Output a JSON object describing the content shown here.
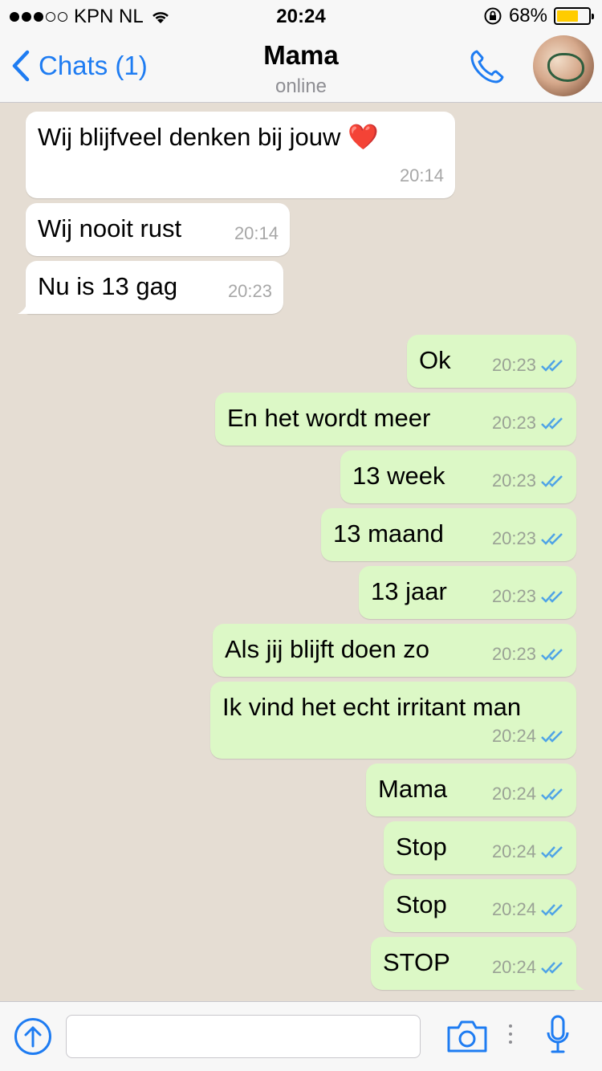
{
  "status_bar": {
    "carrier": "KPN NL",
    "time": "20:24",
    "battery": "68%"
  },
  "nav": {
    "back_label": "Chats (1)",
    "contact_name": "Mama",
    "contact_status": "online"
  },
  "messages": [
    {
      "dir": "in",
      "text": "Wij blijfveel denken bij jouw ❤️",
      "time": "20:14"
    },
    {
      "dir": "in",
      "text": "Wij nooit rust",
      "time": "20:14"
    },
    {
      "dir": "in",
      "text": "Nu is 13 gag",
      "time": "20:23"
    },
    {
      "dir": "out",
      "text": "Ok",
      "time": "20:23"
    },
    {
      "dir": "out",
      "text": "En het wordt meer",
      "time": "20:23"
    },
    {
      "dir": "out",
      "text": "13 week",
      "time": "20:23"
    },
    {
      "dir": "out",
      "text": "13 maand",
      "time": "20:23"
    },
    {
      "dir": "out",
      "text": "13 jaar",
      "time": "20:23"
    },
    {
      "dir": "out",
      "text": "Als jij blijft doen zo",
      "time": "20:23"
    },
    {
      "dir": "out",
      "text": "Ik vind het echt irritant man",
      "time": "20:24"
    },
    {
      "dir": "out",
      "text": "Mama",
      "time": "20:24"
    },
    {
      "dir": "out",
      "text": "Stop",
      "time": "20:24"
    },
    {
      "dir": "out",
      "text": "Stop",
      "time": "20:24"
    },
    {
      "dir": "out",
      "text": "STOP",
      "time": "20:24"
    }
  ],
  "colors": {
    "accent": "#1e7cf2",
    "outgoing_bubble": "#dcf8c6",
    "incoming_bubble": "#ffffff",
    "chat_background": "#e5ddd3",
    "read_ticks": "#4fa3e6"
  }
}
